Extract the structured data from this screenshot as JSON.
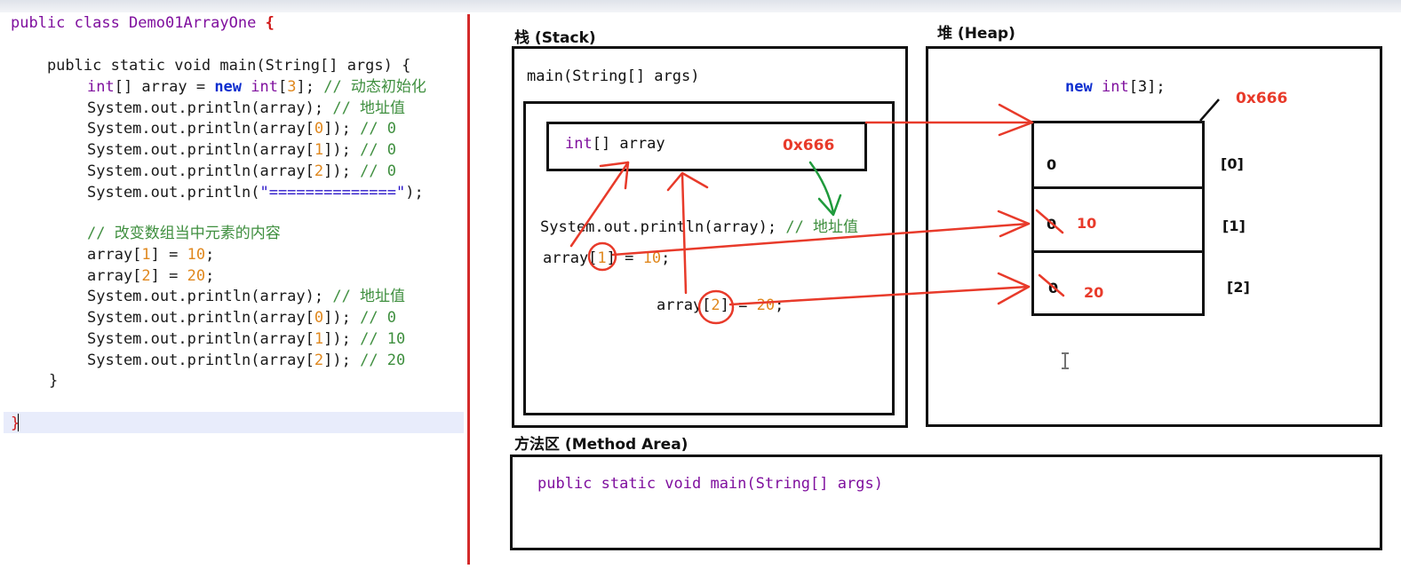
{
  "code": {
    "line1": {
      "a": "public class Demo01ArrayOne ",
      "b": "{"
    },
    "line2": {
      "a": "    public static void main(String[] args) {"
    },
    "line3": {
      "a": "int",
      "b": "[] array = ",
      "c": "new",
      "d": " ",
      "e": "int",
      "f": "[",
      "g": "3",
      "h": "]; ",
      "i": "// 动态初始化"
    },
    "line4": {
      "a": "System.out.println(array); ",
      "b": "// 地址值"
    },
    "line5": {
      "a": "System.out.println(array[",
      "b": "0",
      "c": "]); ",
      "d": "// 0"
    },
    "line6": {
      "a": "System.out.println(array[",
      "b": "1",
      "c": "]); ",
      "d": "// 0"
    },
    "line7": {
      "a": "System.out.println(array[",
      "b": "2",
      "c": "]); ",
      "d": "// 0"
    },
    "line8": {
      "a": "System.out.println(",
      "b": "\"==============\"",
      "c": ");"
    },
    "line9": {
      "a": "// 改变数组当中元素的内容"
    },
    "line10": {
      "a": "array[",
      "b": "1",
      "c": "] = ",
      "d": "10",
      "e": ";"
    },
    "line11": {
      "a": "array[",
      "b": "2",
      "c": "] = ",
      "d": "20",
      "e": ";"
    },
    "line12": {
      "a": "System.out.println(array); ",
      "b": "// 地址值"
    },
    "line13": {
      "a": "System.out.println(array[",
      "b": "0",
      "c": "]); ",
      "d": "// 0"
    },
    "line14": {
      "a": "System.out.println(array[",
      "b": "1",
      "c": "]); ",
      "d": "// 10"
    },
    "line15": {
      "a": "System.out.println(array[",
      "b": "2",
      "c": "]); ",
      "d": "// 20"
    },
    "line16": {
      "a": "}"
    },
    "line17": {
      "a": "}"
    }
  },
  "stack": {
    "title": "栈 (Stack)",
    "frame_label": "main(String[] args)",
    "var_type": "int",
    "var_rest": "[] array",
    "var_address": "0x666",
    "println_text": "System.out.println(array); ",
    "println_comment": "// 地址值",
    "assign1": {
      "a": "array[",
      "b": "1",
      "c": "] = ",
      "d": "10",
      "e": ";"
    },
    "assign2": {
      "a": "array[",
      "b": "2",
      "c": "] = ",
      "d": "20",
      "e": ";"
    }
  },
  "heap": {
    "title": "堆 (Heap)",
    "new_kw": "new",
    "new_type": "int",
    "new_rest": "[3];",
    "address": "0x666",
    "cells": [
      {
        "old": "0",
        "new": "",
        "index": "[0]"
      },
      {
        "old": "0",
        "new": "10",
        "index": "[1]"
      },
      {
        "old": "0",
        "new": "20",
        "index": "[2]"
      }
    ]
  },
  "method_area": {
    "title": "方法区 (Method Area)",
    "signature": "public static void main(String[] args)"
  },
  "colors": {
    "annotation": "#e83a2a",
    "arrow_green": "#1f9a3c",
    "divider": "#d42a2a"
  }
}
